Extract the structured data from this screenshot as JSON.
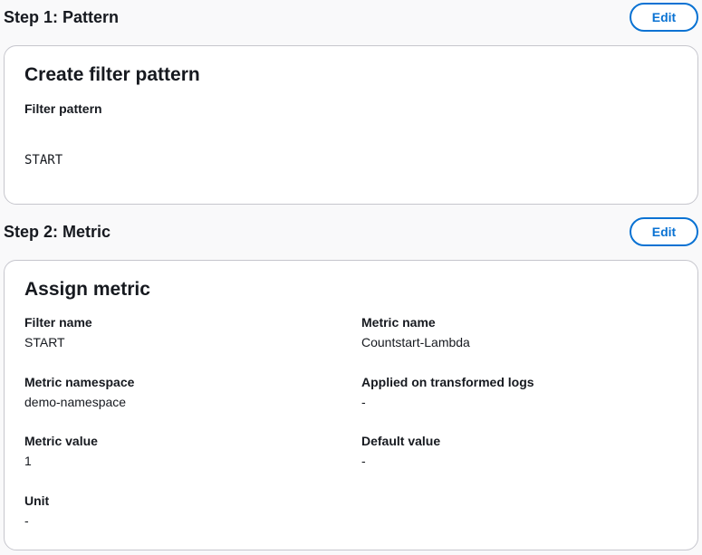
{
  "step1": {
    "title": "Step 1: Pattern",
    "edit_label": "Edit",
    "card": {
      "title": "Create filter pattern",
      "filter_pattern_label": "Filter pattern",
      "filter_pattern_value": "START"
    }
  },
  "step2": {
    "title": "Step 2: Metric",
    "edit_label": "Edit",
    "card": {
      "title": "Assign metric",
      "fields": [
        {
          "label": "Filter name",
          "value": "START"
        },
        {
          "label": "Metric name",
          "value": "Countstart-Lambda"
        },
        {
          "label": "Metric namespace",
          "value": "demo-namespace"
        },
        {
          "label": "Applied on transformed logs",
          "value": "-"
        },
        {
          "label": "Metric value",
          "value": "1"
        },
        {
          "label": "Default value",
          "value": "-"
        },
        {
          "label": "Unit",
          "value": "-"
        }
      ]
    }
  },
  "colors": {
    "accent": "#0972d3",
    "background": "#f9f9fa",
    "card_border": "#c6c6cd",
    "text": "#16191f"
  }
}
